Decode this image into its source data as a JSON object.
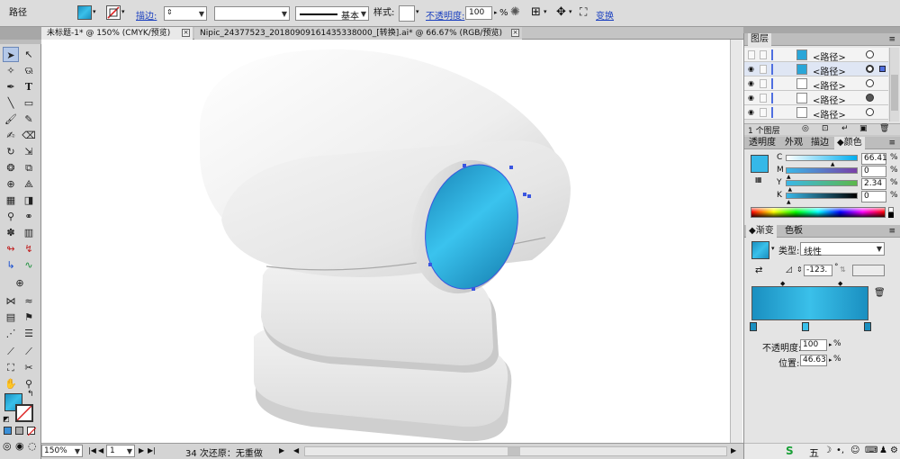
{
  "control_bar": {
    "object_label": "路径",
    "stroke_link": "描边:",
    "stroke_weight": "",
    "profile_value": "",
    "brush_label": "基本",
    "style_label": "样式:",
    "opacity_link": "不透明度:",
    "opacity_value": "100",
    "opacity_unit": "%",
    "transform_link": "变换",
    "fill_color": "#27a8de",
    "stroke_color": "none"
  },
  "doc_tabs": [
    {
      "label": "未标题-1* @ 150% (CMYK/预览)",
      "close": "☒"
    },
    {
      "label": "Nipic_24377523_20180909161435338000_[转换].ai* @ 66.67% (RGB/预览)",
      "close": "☒"
    }
  ],
  "status_bar": {
    "zoom": "150%",
    "artboard": "1",
    "message": "34 次还原：无重做"
  },
  "layers_panel": {
    "title": "图层",
    "rows": [
      {
        "name": "<路径>",
        "thumb": "blue"
      },
      {
        "name": "<路径>",
        "thumb": "blue"
      },
      {
        "name": "<路径>",
        "thumb": "white"
      },
      {
        "name": "<路径>",
        "thumb": "white"
      },
      {
        "name": "<路径>",
        "thumb": "white"
      }
    ],
    "footer": "1 个图层"
  },
  "color_panel": {
    "tabs": [
      "透明度",
      "外观",
      "描边",
      "颜色"
    ],
    "active_tab": "颜色",
    "swatch_color": "#35b8e8",
    "channels": [
      {
        "name": "C",
        "value": "66.41",
        "unit": "%",
        "level": 0.66
      },
      {
        "name": "M",
        "value": "0",
        "unit": "%",
        "level": 0.0
      },
      {
        "name": "Y",
        "value": "2.34",
        "unit": "%",
        "level": 0.02
      },
      {
        "name": "K",
        "value": "0",
        "unit": "%",
        "level": 0.0
      }
    ]
  },
  "gradient_panel": {
    "tabs": [
      "渐变",
      "色板"
    ],
    "active_tab": "渐变",
    "type_label": "类型:",
    "type_value": "线性",
    "angle_value": "-123.",
    "angle_unit": "°",
    "opacity_label": "不透明度:",
    "opacity_value": "100",
    "location_label": "位置:",
    "location_value": "46.63",
    "unit": "%",
    "stops": [
      "#1a8fc0",
      "#3ac0ea",
      "#1a8fc0"
    ]
  }
}
